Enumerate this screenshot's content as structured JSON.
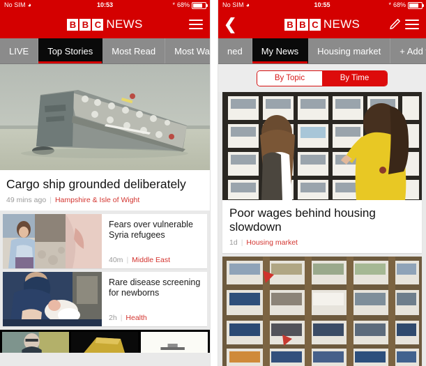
{
  "left_phone": {
    "status_bar": {
      "carrier": "No SIM",
      "wifi_icon": "wifi-icon",
      "time": "10:53",
      "bluetooth_icon": "bluetooth-icon",
      "battery_percent": "68%",
      "battery_icon": "battery-icon"
    },
    "nav": {
      "logo_letters": [
        "B",
        "B",
        "C"
      ],
      "logo_word": "NEWS",
      "menu_icon": "hamburger-menu-icon"
    },
    "tabs": [
      {
        "label": "LIVE",
        "active": false
      },
      {
        "label": "Top Stories",
        "active": true
      },
      {
        "label": "Most Read",
        "active": false
      },
      {
        "label": "Most Wat",
        "active": false
      }
    ],
    "lead_story": {
      "image_alt": "capsized cargo ship in water",
      "headline": "Cargo ship grounded deliberately",
      "age": "49 mins ago",
      "separator": "|",
      "topic": "Hampshire & Isle of Wight"
    },
    "stories": [
      {
        "image_alt": "child wrapped in blanket at refugee camp",
        "headline": "Fears over vulnerable Syria refugees",
        "age": "40m",
        "separator": "|",
        "topic": "Middle East"
      },
      {
        "image_alt": "nurse holding a newborn baby",
        "headline": "Rare disease screening for newborns",
        "age": "2h",
        "separator": "|",
        "topic": "Health"
      }
    ],
    "bottom_strip": [
      {
        "image_alt": "man seated in green room"
      },
      {
        "image_alt": "yellow building structure"
      },
      {
        "image_alt": "white background with small boat"
      }
    ]
  },
  "right_phone": {
    "status_bar": {
      "carrier": "No SIM",
      "wifi_icon": "wifi-icon",
      "time": "10:55",
      "bluetooth_icon": "bluetooth-icon",
      "battery_percent": "68%",
      "battery_icon": "battery-icon"
    },
    "nav": {
      "back_icon": "chevron-left-icon",
      "logo_letters": [
        "B",
        "B",
        "C"
      ],
      "logo_word": "NEWS",
      "edit_icon": "pencil-edit-icon",
      "menu_icon": "hamburger-menu-icon"
    },
    "tabs": [
      {
        "label": "ned",
        "active": false
      },
      {
        "label": "My News",
        "active": true
      },
      {
        "label": "Housing market",
        "active": false
      },
      {
        "label": "+ Add to",
        "active": false
      }
    ],
    "segmented_control": [
      {
        "label": "By Topic",
        "selected": false
      },
      {
        "label": "By Time",
        "selected": true
      }
    ],
    "stories": [
      {
        "image_alt": "two women looking at estate agent window listings",
        "headline": "Poor wages behind housing slowdown",
        "age": "1d",
        "separator": "|",
        "topic": "Housing market"
      },
      {
        "image_alt": "estate agent shop window full of property listings",
        "headline": "",
        "age": "",
        "separator": "",
        "topic": ""
      }
    ]
  },
  "colors": {
    "bbc_red": "#d40000",
    "tab_gray": "#8b8b8b",
    "active_tab_black": "#0a0a0a",
    "topic_red": "#d3342f",
    "meta_gray": "#9a9a9a",
    "page_bg": "#e9e9e9"
  }
}
